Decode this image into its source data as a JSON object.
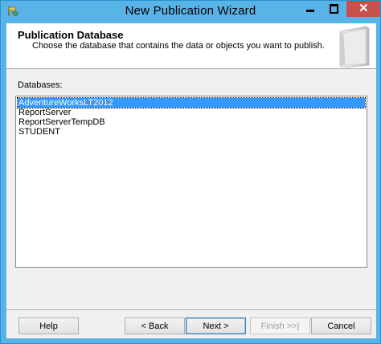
{
  "window": {
    "title": "New Publication Wizard",
    "icon": "wizard-app-icon",
    "controls": {
      "minimize_icon": "minimize-icon",
      "maximize_icon": "maximize-icon",
      "close_label": "✕"
    }
  },
  "header": {
    "title": "Publication Database",
    "description": "Choose the database that contains the data or objects you want to publish.",
    "graphic": "wizard-page-graphic"
  },
  "databases": {
    "label": "Databases:",
    "items": [
      "AdventureWorksLT2012",
      "ReportServer",
      "ReportServerTempDB",
      "STUDENT"
    ],
    "selected": "AdventureWorksLT2012"
  },
  "buttons": {
    "help": "Help",
    "back": "< Back",
    "next": "Next >",
    "finish": "Finish >>|",
    "cancel": "Cancel"
  },
  "colors": {
    "titlebar": "#58b3e6",
    "close_button": "#c7504b",
    "selection": "#3399ff"
  }
}
